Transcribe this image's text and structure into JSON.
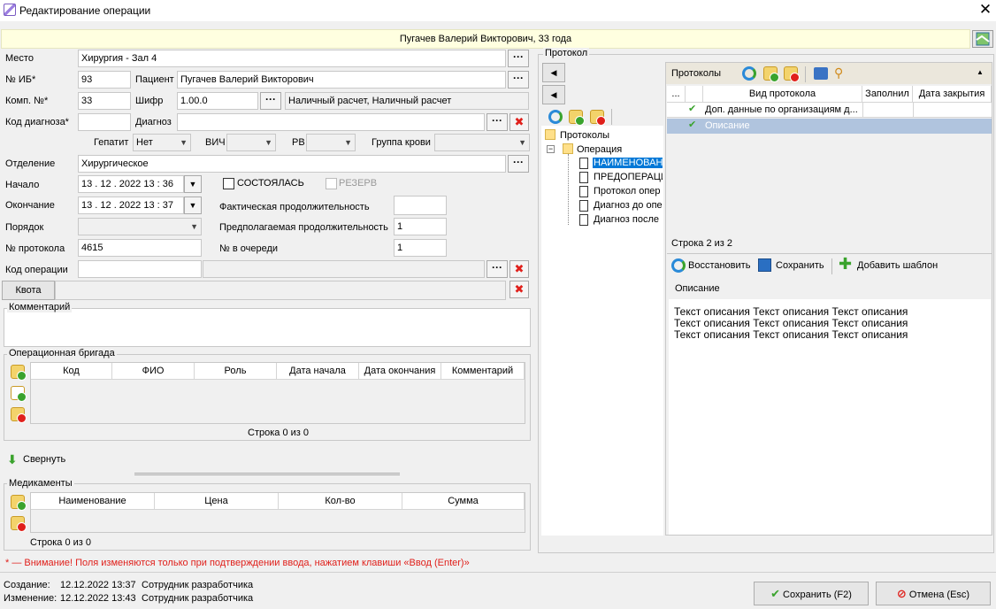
{
  "window": {
    "title": "Редактирование операции",
    "close": "✕"
  },
  "banner": {
    "text": "Пугачев Валерий Викторович, 33 года"
  },
  "form": {
    "place_label": "Место",
    "place_value": "Хирургия - Зал 4",
    "ib_label": "№ ИБ*",
    "ib_value": "93",
    "patient_label": "Пациент",
    "patient_value": "Пугачев Валерий Викторович",
    "komp_label": "Комп. №*",
    "komp_value": "33",
    "cipher_label": "Шифр",
    "cipher_value": "1.00.0",
    "payment_value": "Наличный расчет, Наличный расчет",
    "diag_code_label": "Код диагноза*",
    "diag_code_value": "",
    "diag_label": "Диагноз",
    "diag_value": "",
    "hepatitis_label": "Гепатит",
    "hepatitis_value": "Нет",
    "hiv_label": "ВИЧ",
    "hiv_value": "",
    "rv_label": "РВ",
    "rv_value": "",
    "blood_label": "Группа крови",
    "blood_value": "",
    "dept_label": "Отделение",
    "dept_value": "Хирургическое",
    "start_label": "Начало",
    "start_value": "13 . 12 . 2022   13 : 36",
    "end_label": "Окончание",
    "end_value": "13 . 12 . 2022   13 : 37",
    "took_place_label": "СОСТОЯЛАСЬ",
    "reserve_label": "РЕЗЕРВ",
    "actual_dur_label": "Фактическая продолжительность",
    "actual_dur_value": "",
    "planned_dur_label": "Предполагаемая продолжительность",
    "planned_dur_value": "1",
    "order_label": "Порядок",
    "order_value": "",
    "queue_label": "№ в очереди",
    "queue_value": "1",
    "protocol_no_label": "№ протокола",
    "protocol_no_value": "4615",
    "op_code_label": "Код операции",
    "op_code_value": "",
    "quota_label": "Квота",
    "comment_label": "Комментарий"
  },
  "brigade": {
    "title": "Операционная бригада",
    "columns": [
      "Код",
      "ФИО",
      "Роль",
      "Дата начала",
      "Дата окончания",
      "Комментарий"
    ],
    "footer": "Строка 0 из 0"
  },
  "collapse_label": "Свернуть",
  "meds": {
    "title": "Медикаменты",
    "columns": [
      "Наименование",
      "Цена",
      "Кол-во",
      "Сумма"
    ],
    "footer": "Строка 0 из 0"
  },
  "warning": "* — Внимание! Поля изменяются только при подтверждении ввода, нажатием клавиши «Ввод (Enter)»",
  "meta": {
    "created_label": "Создание:",
    "created_value": "12.12.2022 13:37",
    "created_user": "Сотрудник разработчика",
    "changed_label": "Изменение:",
    "changed_value": "12.12.2022 13:43",
    "changed_user": "Сотрудник разработчика"
  },
  "footer_buttons": {
    "save": "Сохранить (F2)",
    "cancel": "Отмена (Esc)"
  },
  "protocol": {
    "group_title": "Протокол",
    "tree": {
      "root": "Протоколы",
      "node": "Операция",
      "children": [
        "НАИМЕНОВАНИ",
        "ПРЕДОПЕРАЦИ",
        "Протокол опер",
        "Диагноз до опе",
        "Диагноз после"
      ]
    },
    "list_title": "Протоколы",
    "columns": [
      "...",
      "",
      "Вид протокола",
      "Заполнил",
      "Дата закрытия"
    ],
    "rows": [
      {
        "name": "Доп. данные по организациям д..."
      },
      {
        "name": "Описание"
      }
    ],
    "status": "Строка 2 из 2",
    "restore": "Восстановить",
    "save": "Сохранить",
    "add_template": "Добавить шаблон",
    "desc_title": "Описание",
    "desc_lines": [
      "Текст описания Текст описания Текст описания",
      "Текст описания Текст описания Текст описания",
      "Текст описания Текст описания Текст описания"
    ]
  }
}
